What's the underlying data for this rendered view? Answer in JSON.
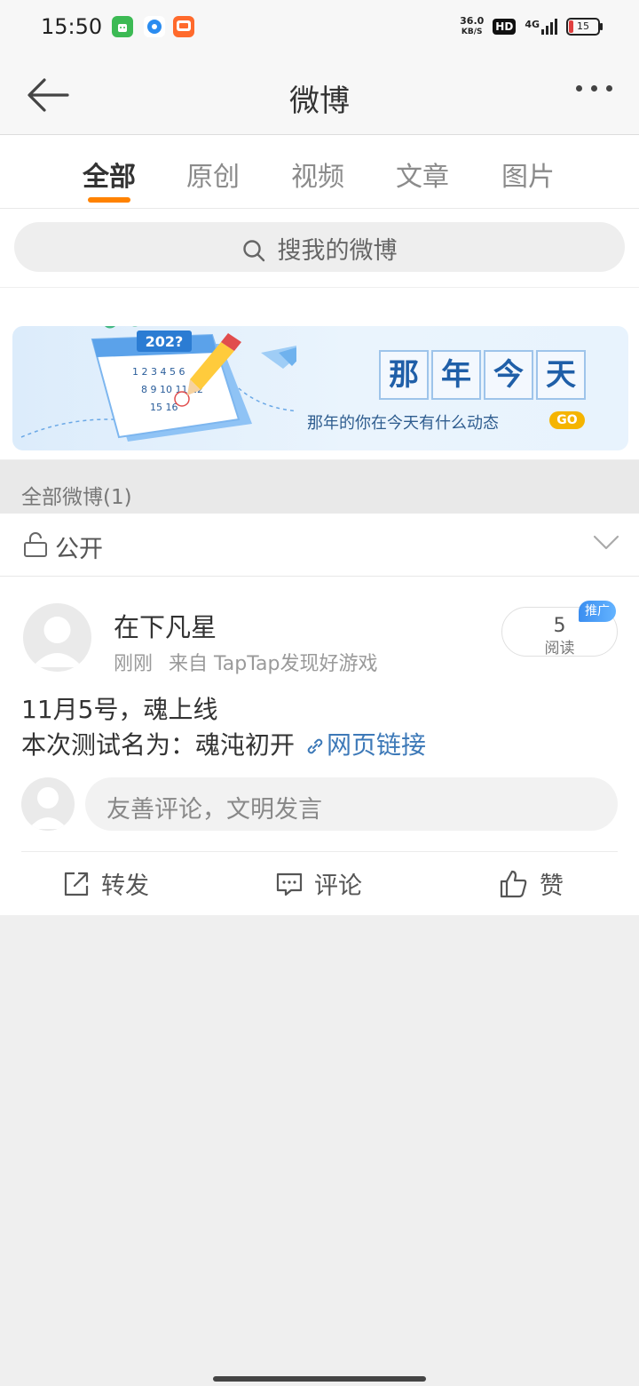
{
  "status_bar": {
    "time": "15:50",
    "net_speed_value": "36.0",
    "net_speed_unit": "KB/S",
    "hd": "HD",
    "network": "4G",
    "battery": "15"
  },
  "nav": {
    "title": "微博"
  },
  "tabs": [
    {
      "label": "全部",
      "active": true
    },
    {
      "label": "原创",
      "active": false
    },
    {
      "label": "视频",
      "active": false
    },
    {
      "label": "文章",
      "active": false
    },
    {
      "label": "图片",
      "active": false
    }
  ],
  "search": {
    "placeholder": "搜我的微博"
  },
  "banner": {
    "calendar_year": "202?",
    "title_chars": [
      "那",
      "年",
      "今",
      "天"
    ],
    "subtitle": "那年的你在今天有什么动态",
    "go": "GO"
  },
  "section": {
    "label": "全部微博(1)"
  },
  "filter": {
    "label": "公开"
  },
  "post": {
    "username": "在下凡星",
    "time": "刚刚",
    "source": "来自 TapTap发现好游戏",
    "read_count": "5",
    "read_label": "阅读",
    "promo": "推广",
    "line1": "11月5号，魂上线",
    "line2_prefix": "本次测试名为：魂沌初开",
    "link_label": "网页链接",
    "comment_placeholder": "友善评论，文明发言"
  },
  "actions": {
    "repost": "转发",
    "comment": "评论",
    "like": "赞"
  },
  "colors": {
    "accent": "#ff8200",
    "link": "#3d79b8",
    "promo": "#3b8ef0"
  }
}
